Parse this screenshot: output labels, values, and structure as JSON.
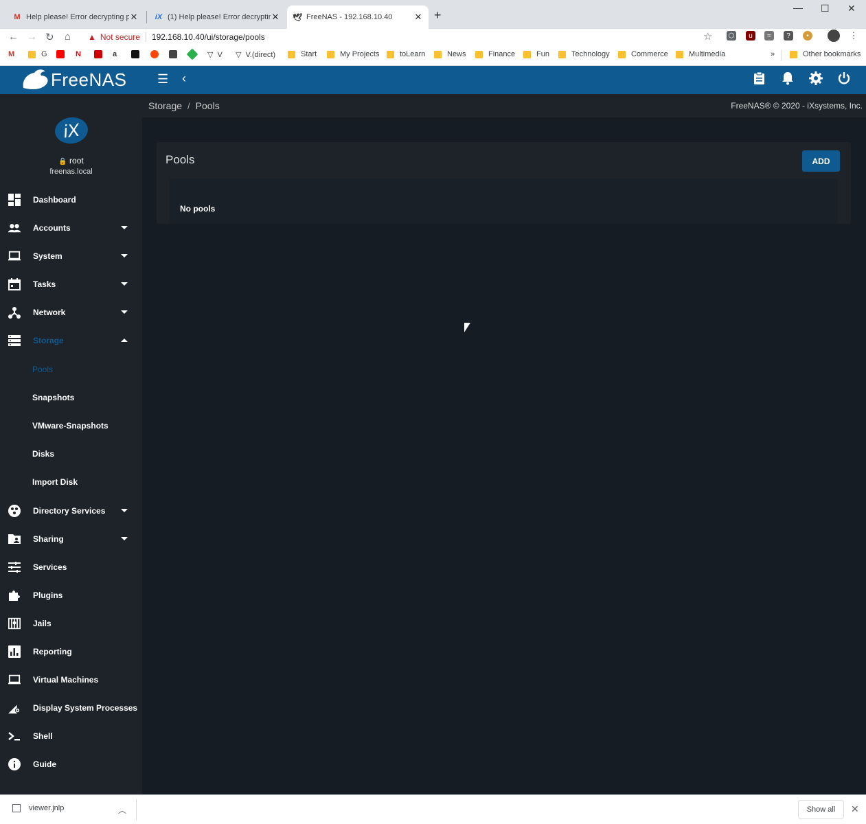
{
  "browser": {
    "tabs": [
      {
        "title": "Help please! Error decrypting po",
        "favicon": "gmail-icon",
        "active": false
      },
      {
        "title": "(1) Help please! Error decrypting",
        "favicon": "ix-icon",
        "active": false
      },
      {
        "title": "FreeNAS - 192.168.10.40",
        "favicon": "freenas-icon",
        "active": true
      }
    ],
    "new_tab": "+",
    "window_controls": {
      "minimize": "—",
      "maximize": "☐",
      "close": "✕"
    },
    "address": {
      "security_label": "Not secure",
      "url": "192.168.10.40/ui/storage/pools"
    },
    "bookmarks": [
      {
        "label": "G"
      },
      {
        "label": "V"
      },
      {
        "label": "V.(direct)"
      },
      {
        "label": "Start"
      },
      {
        "label": "My Projects"
      },
      {
        "label": "toLearn"
      },
      {
        "label": "News"
      },
      {
        "label": "Finance"
      },
      {
        "label": "Fun"
      },
      {
        "label": "Technology"
      },
      {
        "label": "Commerce"
      },
      {
        "label": "Multimedia"
      }
    ],
    "bookmarks_overflow": "»",
    "other_bookmarks": "Other bookmarks"
  },
  "app": {
    "brand": "FreeNAS",
    "brand_color": "#0f5a91"
  },
  "profile": {
    "logo_text": "iX",
    "user": "root",
    "host": "freenas.local"
  },
  "nav": {
    "items": [
      {
        "label": "Dashboard",
        "icon": "dashboard-icon"
      },
      {
        "label": "Accounts",
        "icon": "accounts-icon",
        "expandable": true
      },
      {
        "label": "System",
        "icon": "laptop-icon",
        "expandable": true
      },
      {
        "label": "Tasks",
        "icon": "calendar-icon",
        "expandable": true
      },
      {
        "label": "Network",
        "icon": "network-icon",
        "expandable": true
      },
      {
        "label": "Storage",
        "icon": "storage-icon",
        "expandable": true,
        "expanded": true
      },
      {
        "label": "Directory Services",
        "icon": "directory-icon",
        "expandable": true
      },
      {
        "label": "Sharing",
        "icon": "folder-share-icon",
        "expandable": true
      },
      {
        "label": "Services",
        "icon": "tune-icon"
      },
      {
        "label": "Plugins",
        "icon": "puzzle-icon"
      },
      {
        "label": "Jails",
        "icon": "jail-icon"
      },
      {
        "label": "Reporting",
        "icon": "chart-icon"
      },
      {
        "label": "Virtual Machines",
        "icon": "laptop-icon"
      },
      {
        "label": "Display System Processes",
        "icon": "processes-icon"
      },
      {
        "label": "Shell",
        "icon": "terminal-icon"
      },
      {
        "label": "Guide",
        "icon": "info-icon"
      }
    ],
    "storage_sub": [
      {
        "label": "Pools",
        "active": true
      },
      {
        "label": "Snapshots"
      },
      {
        "label": "VMware-Snapshots"
      },
      {
        "label": "Disks"
      },
      {
        "label": "Import Disk"
      }
    ]
  },
  "breadcrumb": {
    "section": "Storage",
    "separator": "/",
    "page": "Pools"
  },
  "copyright": "FreeNAS® © 2020 - iXsystems, Inc.",
  "pools_card": {
    "title": "Pools",
    "add_label": "ADD",
    "empty_text": "No pools"
  },
  "downloads": {
    "file": "viewer.jnlp",
    "show_all": "Show all"
  }
}
